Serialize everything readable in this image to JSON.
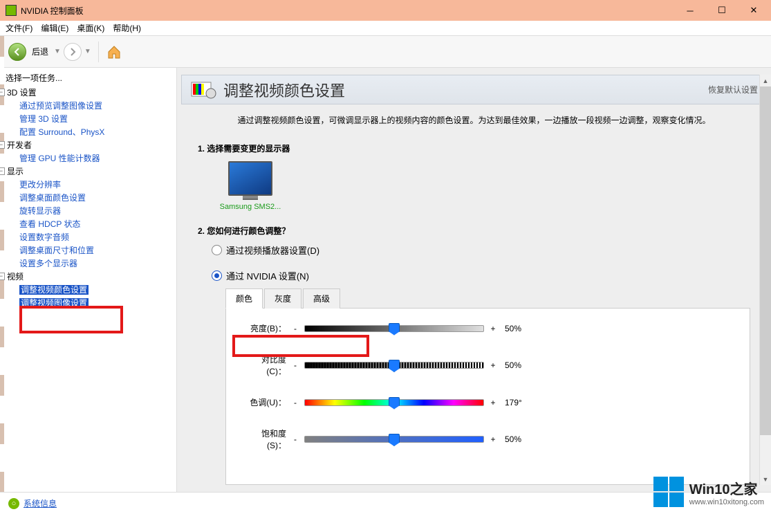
{
  "title": "NVIDIA 控制面板",
  "menu": {
    "file": "文件(F)",
    "edit": "编辑(E)",
    "desktop": "桌面(K)",
    "help": "帮助(H)"
  },
  "toolbar": {
    "back": "后退"
  },
  "sidebar": {
    "task_label": "选择一项任务...",
    "cat_3d": "3D 设置",
    "items_3d": [
      "通过预览调整图像设置",
      "管理 3D 设置",
      "配置 Surround、PhysX"
    ],
    "cat_dev": "开发者",
    "items_dev": [
      "管理 GPU 性能计数器"
    ],
    "cat_display": "显示",
    "items_display": [
      "更改分辨率",
      "调整桌面颜色设置",
      "旋转显示器",
      "查看 HDCP 状态",
      "设置数字音频",
      "调整桌面尺寸和位置",
      "设置多个显示器"
    ],
    "cat_video": "视频",
    "items_video": [
      "调整视频颜色设置",
      "调整视频图像设置"
    ]
  },
  "main": {
    "header": "调整视频颜色设置",
    "restore": "恢复默认设置",
    "desc": "通过调整视频颜色设置，可微调显示器上的视频内容的颜色设置。为达到最佳效果，一边播放一段视频一边调整，观察变化情况。",
    "section1_title": "1. 选择需要变更的显示器",
    "monitor_name": "Samsung SMS2...",
    "section2_title": "2. 您如何进行颜色调整？",
    "radio_player": "通过视频播放器设置(D)",
    "radio_nvidia": "通过 NVIDIA 设置(N)",
    "tabs": {
      "color": "颜色",
      "gamma": "灰度",
      "advanced": "高级"
    },
    "sliders": [
      {
        "label": "亮度(B)：",
        "value": "50%",
        "pos": 50,
        "track": "track-brightness"
      },
      {
        "label": "对比度(C)：",
        "value": "50%",
        "pos": 50,
        "track": "track-contrast"
      },
      {
        "label": "色调(U)：",
        "value": "179°",
        "pos": 50,
        "track": "track-hue"
      },
      {
        "label": "饱和度(S)：",
        "value": "50%",
        "pos": 50,
        "track": "track-sat"
      }
    ]
  },
  "footer": {
    "sysinfo": "系统信息"
  },
  "watermark": {
    "title": "Win10之家",
    "url": "www.win10xitong.com"
  }
}
